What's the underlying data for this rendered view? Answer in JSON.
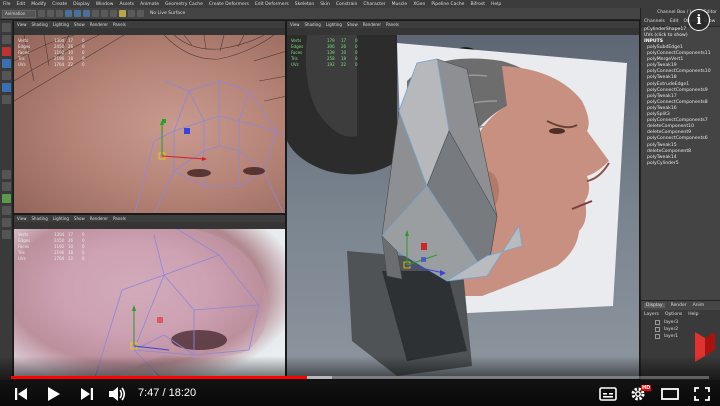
{
  "menubar": [
    "File",
    "Edit",
    "Modify",
    "Create",
    "Display",
    "Window",
    "Assets",
    "Animate",
    "Geometry Cache",
    "Create Deformers",
    "Edit Deformers",
    "Skeleton",
    "Skin",
    "Constrain",
    "Character",
    "Muscle",
    "XGen",
    "Pipeline Cache",
    "Bifrost",
    "Help"
  ],
  "shelf": {
    "mode": "Animation",
    "surface_label": "No Live Surface"
  },
  "viewport_menu": [
    "View",
    "Shading",
    "Lighting",
    "Show",
    "Renderer",
    "Panels"
  ],
  "hud_labels": [
    "Verts",
    "Edges",
    "Faces",
    "Tris",
    "UVs"
  ],
  "hud_tl": [
    [
      "1304",
      "17",
      "0"
    ],
    [
      "2450",
      "26",
      "0"
    ],
    [
      "1192",
      "10",
      "0"
    ],
    [
      "2196",
      "18",
      "0"
    ],
    [
      "1764",
      "22",
      "0"
    ]
  ],
  "hud_bl": [
    [
      "1304",
      "17",
      "0"
    ],
    [
      "2450",
      "26",
      "0"
    ],
    [
      "1192",
      "10",
      "0"
    ],
    [
      "2196",
      "18",
      "0"
    ],
    [
      "1764",
      "22",
      "0"
    ]
  ],
  "hud_r": [
    [
      "179",
      "17",
      "0"
    ],
    [
      "306",
      "26",
      "0"
    ],
    [
      "139",
      "10",
      "0"
    ],
    [
      "258",
      "18",
      "0"
    ],
    [
      "192",
      "22",
      "0"
    ]
  ],
  "panel": {
    "title": "Channel Box / Layer Editor",
    "tabs": [
      "Channels",
      "Edit",
      "Object",
      "Show"
    ],
    "shape": "pCylinderShape17",
    "click_hint": "UVs (click to show)",
    "inputs_header": "INPUTS",
    "inputs": [
      "polySubdEdge1",
      "polyConnectComponents11",
      "polyMergeVert1",
      "polyTweak19",
      "polyConnectComponents10",
      "polyTweak18",
      "polyExtrudeEdge1",
      "polyConnectComponents9",
      "polyTweak17",
      "polyConnectComponents8",
      "polyTweak16",
      "polySplit3",
      "polyConnectComponents7",
      "deleteComponent10",
      "deleteComponent9",
      "polyConnectComponents6",
      "polyTweak15",
      "deleteComponent8",
      "polyTweak14",
      "polyCylinder5"
    ],
    "layer_tabs": [
      "Display",
      "Render",
      "Anim"
    ],
    "layer_menu": [
      "Layers",
      "Options",
      "Help"
    ],
    "layers": [
      "layer3",
      "layer2",
      "layer1"
    ]
  },
  "player": {
    "current_time": "7:47",
    "duration": "18:20",
    "progress_fraction": 0.4245,
    "loaded_fraction": 0.46,
    "hd_label": "HD"
  }
}
